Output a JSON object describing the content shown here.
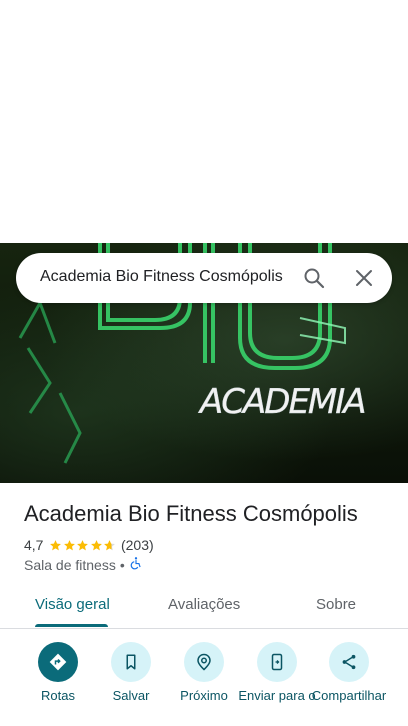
{
  "search": {
    "query": "Academia Bio Fitness Cosmópolis"
  },
  "hero": {
    "sign_text": "ACADEMIA"
  },
  "place": {
    "name": "Academia Bio Fitness Cosmópolis",
    "rating": "4,7",
    "rating_value": 4.7,
    "review_count": "(203)",
    "category": "Sala de fitness",
    "separator": "•"
  },
  "tabs": [
    {
      "label": "Visão geral",
      "active": true
    },
    {
      "label": "Avaliações",
      "active": false
    },
    {
      "label": "Sobre",
      "active": false
    }
  ],
  "actions": [
    {
      "label": "Rotas",
      "icon": "directions-icon"
    },
    {
      "label": "Salvar",
      "icon": "bookmark-icon"
    },
    {
      "label": "Próximo",
      "icon": "nearby-icon"
    },
    {
      "label": "Enviar para o",
      "icon": "send-to-phone-icon"
    },
    {
      "label": "Compartilhar",
      "icon": "share-icon"
    }
  ],
  "colors": {
    "accent": "#0b6b7a",
    "action_bg": "#d6f3f8",
    "star": "#fbbc04",
    "neon": "#39d36b"
  }
}
